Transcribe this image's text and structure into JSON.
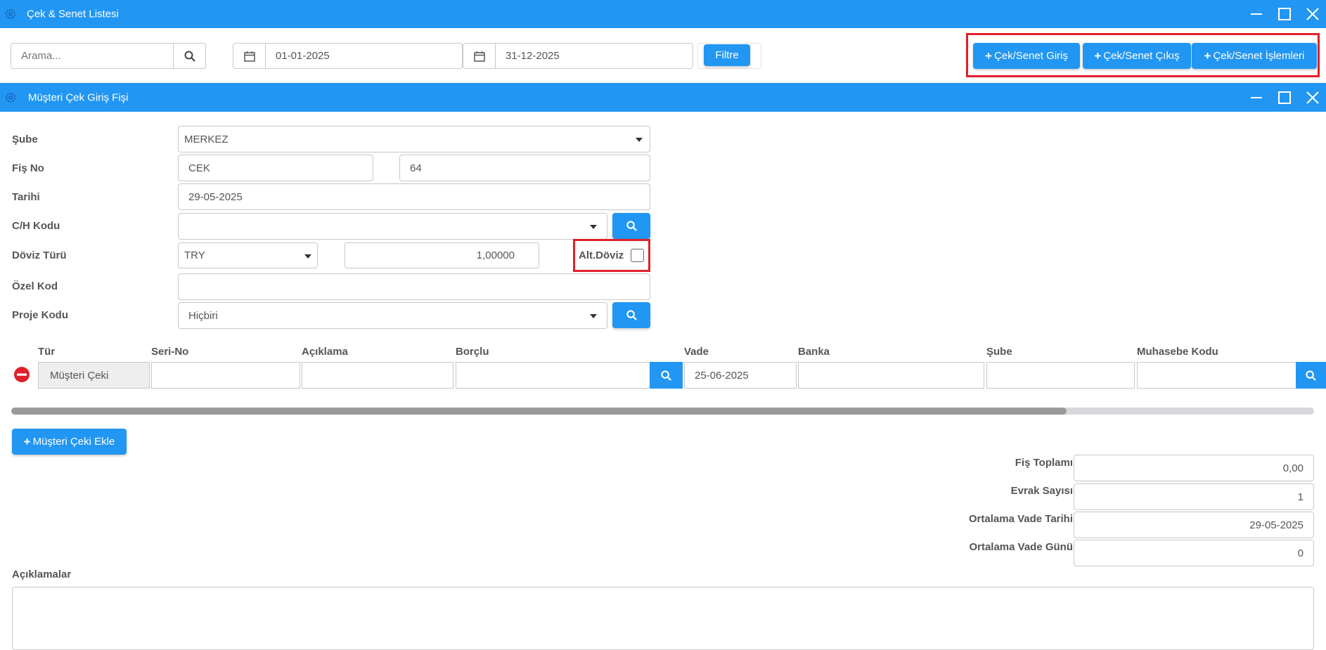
{
  "outer_window": {
    "title": "Çek & Senet Listesi",
    "search_placeholder": "Arama...",
    "date_from": "01-01-2025",
    "date_to": "31-12-2025",
    "filter_label": "Filtre",
    "actions": [
      "Çek/Senet Giriş",
      "Çek/Senet Çıkış",
      "Çek/Senet İşlemleri"
    ]
  },
  "inner_window": {
    "title": "Müşteri Çek Giriş Fişi"
  },
  "form": {
    "sube_label": "Şube",
    "sube_value": "MERKEZ",
    "fis_no_label": "Fiş No",
    "fis_no_series": "CEK",
    "fis_no_number": "64",
    "tarihi_label": "Tarihi",
    "tarihi_value": "29-05-2025",
    "ch_kodu_label": "C/H Kodu",
    "ch_kodu_value": "",
    "doviz_turu_label": "Döviz Türü",
    "doviz_turu_value": "TRY",
    "doviz_kuru": "1,00000",
    "alt_doviz_label": "Alt.Döviz",
    "alt_doviz_checked": false,
    "ozel_kod_label": "Özel Kod",
    "ozel_kod_value": "",
    "proje_kodu_label": "Proje Kodu",
    "proje_kodu_value": "Hiçbiri"
  },
  "grid": {
    "columns": [
      "Tür",
      "Seri-No",
      "Açıklama",
      "Borçlu",
      "Vade",
      "Banka",
      "Şube",
      "Muhasebe Kodu"
    ],
    "rows": [
      {
        "tur": "Müşteri Çeki",
        "seri_no": "",
        "aciklama": "",
        "borclu": "",
        "vade": "25-06-2025",
        "banka": "",
        "sube": "",
        "muhasebe_kodu": ""
      }
    ],
    "scroll_fraction": 0.81
  },
  "add_button_label": "Müşteri Çeki Ekle",
  "totals": {
    "fis_toplami_label": "Fiş Toplamı",
    "fis_toplami": "0,00",
    "evrak_sayisi_label": "Evrak Sayısı",
    "evrak_sayisi": "1",
    "ortalama_vade_tarihi_label": "Ortalama Vade Tarihi",
    "ortalama_vade_tarihi": "29-05-2025",
    "ortalama_vade_gunu_label": "Ortalama Vade Günü",
    "ortalama_vade_gunu": "0"
  },
  "aciklamalar_label": "Açıklamalar",
  "aciklamalar_value": "",
  "colors": {
    "accent": "#2196f3",
    "highlight": "#e0202a",
    "remove": "#e0202a"
  }
}
